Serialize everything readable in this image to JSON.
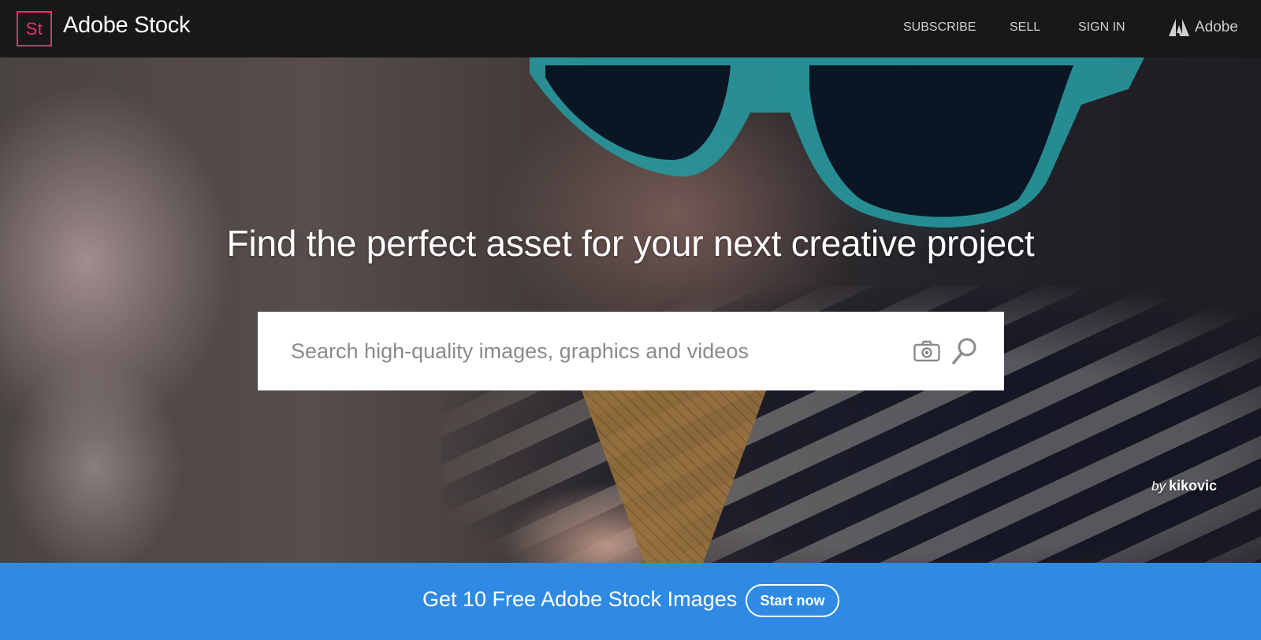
{
  "header": {
    "logo_text": "St",
    "brand": "Adobe Stock",
    "nav": [
      "SUBSCRIBE",
      "SELL",
      "SIGN IN"
    ],
    "adobe_label": "Adobe",
    "logo_color": "#e8326d",
    "background": "#181818"
  },
  "hero": {
    "headline": "Find the perfect asset for your next creative project",
    "search": {
      "placeholder": "Search high-quality images, graphics and videos",
      "camera_icon": "camera-icon",
      "search_icon": "magnifier-icon"
    },
    "credit_by": "by",
    "credit_name": "kikovic"
  },
  "promo": {
    "text": "Get 10 Free Adobe Stock Images",
    "button": "Start now",
    "background": "#2f8ae4"
  }
}
